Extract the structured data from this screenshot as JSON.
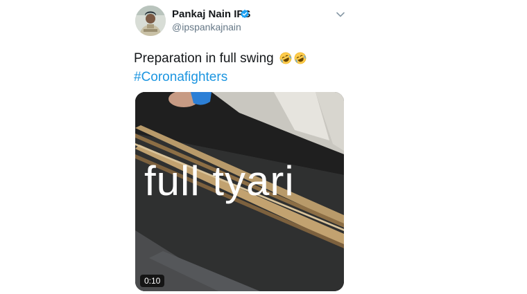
{
  "author": {
    "name": "Pankaj Nain IPS",
    "handle": "@ipspankajnain",
    "verified": true
  },
  "tweet": {
    "text": "Preparation in full swing",
    "emojis": [
      "rolling-on-floor-laughing",
      "rolling-on-floor-laughing"
    ],
    "hashtag": "#Coronafighters"
  },
  "media": {
    "type": "video",
    "overlay_text": "full tyari",
    "duration": "0:10"
  },
  "colors": {
    "link": "#1b95e0",
    "verified": "#1da1f2",
    "handle": "#657786"
  }
}
